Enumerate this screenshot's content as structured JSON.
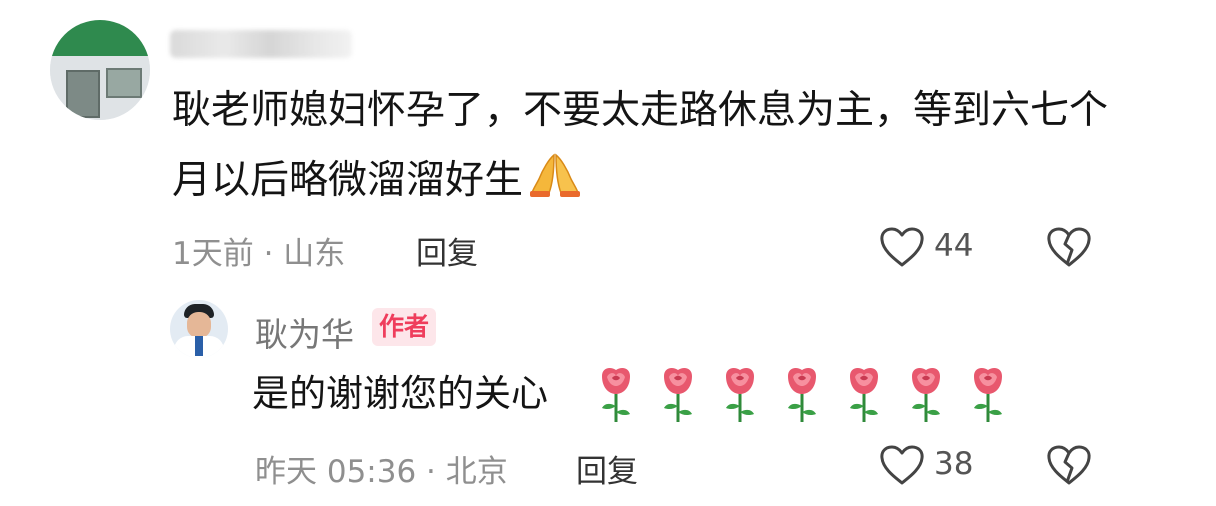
{
  "comment": {
    "text": "耿老师媳妇怀孕了，不要太走路休息为主，等到六七个月以后略微溜溜好生",
    "emoji": "pray-icon",
    "time_location": "1天前 · 山东",
    "reply_label": "回复",
    "likes": "44"
  },
  "reply": {
    "author": "耿为华",
    "badge": "作者",
    "text": "是的谢谢您的关心",
    "emoji": "rose-icon",
    "emoji_count": 7,
    "time_location": "昨天 05:36 · 北京",
    "reply_label": "回复",
    "likes": "38"
  },
  "colors": {
    "badge_text": "#ef3d5c",
    "badge_bg": "#fde6ea",
    "meta_gray": "#8f8f8f",
    "icon_gray": "#444444"
  }
}
